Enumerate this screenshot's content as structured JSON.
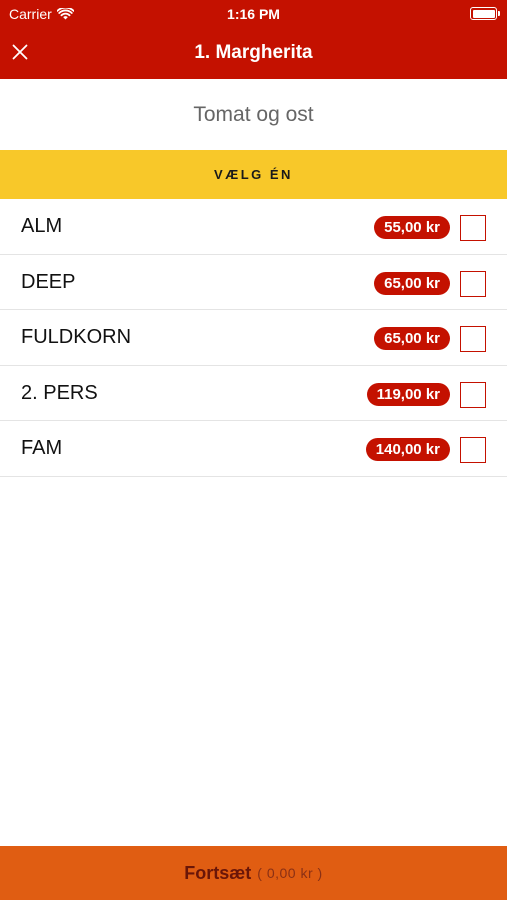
{
  "status_bar": {
    "carrier": "Carrier",
    "time": "1:16 PM"
  },
  "header": {
    "title": "1. Margherita",
    "close_icon": "close-icon"
  },
  "description": "Tomat og ost",
  "section": {
    "title": "VÆLG ÉN"
  },
  "options": [
    {
      "label": "ALM",
      "price": "55,00 kr",
      "checked": false
    },
    {
      "label": "DEEP",
      "price": "65,00 kr",
      "checked": false
    },
    {
      "label": "FULDKORN",
      "price": "65,00 kr",
      "checked": false
    },
    {
      "label": "2. PERS",
      "price": "119,00 kr",
      "checked": false
    },
    {
      "label": "FAM",
      "price": "140,00 kr",
      "checked": false
    }
  ],
  "footer": {
    "button_label": "Fortsæt",
    "total": "( 0,00 kr )"
  },
  "colors": {
    "header_red": "#c41100",
    "section_yellow": "#f8c829",
    "footer_orange": "#e05d12",
    "price_badge": "#c41100"
  }
}
